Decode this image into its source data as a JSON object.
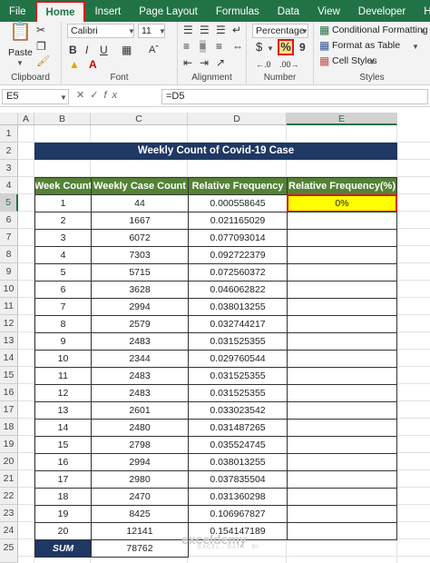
{
  "tabs": [
    {
      "label": "File",
      "active": false
    },
    {
      "label": "Home",
      "active": true
    },
    {
      "label": "Insert",
      "active": false
    },
    {
      "label": "Page Layout",
      "active": false
    },
    {
      "label": "Formulas",
      "active": false
    },
    {
      "label": "Data",
      "active": false
    },
    {
      "label": "View",
      "active": false
    },
    {
      "label": "Developer",
      "active": false
    },
    {
      "label": "Help",
      "active": false
    }
  ],
  "ribbon": {
    "clipboard": {
      "label": "Clipboard",
      "paste": "Paste"
    },
    "font": {
      "label": "Font",
      "name": "Calibri",
      "size": "11",
      "bold": "B",
      "italic": "I",
      "underline": "U"
    },
    "alignment": {
      "label": "Alignment"
    },
    "number": {
      "label": "Number",
      "format": "Percentage",
      "currency": "$",
      "percent": "%",
      "comma": "9"
    },
    "styles": {
      "label": "Styles",
      "conditional": "Conditional Formatting",
      "table": "Format as Table",
      "cell_styles": "Cell Styles"
    }
  },
  "formula_bar": {
    "name_box": "E5",
    "formula": "=D5"
  },
  "columns": [
    "A",
    "B",
    "C",
    "D",
    "E"
  ],
  "rows": [
    "1",
    "2",
    "3",
    "4",
    "5",
    "6",
    "7",
    "8",
    "9",
    "10",
    "11",
    "12",
    "13",
    "14",
    "15",
    "16",
    "17",
    "18",
    "19",
    "20",
    "21",
    "22",
    "23",
    "24",
    "25"
  ],
  "sheet": {
    "title": "Weekly Count of Covid-19 Case",
    "headers": [
      "Week Count",
      "Weekly Case Count",
      "Relative Frequency",
      "Relative Frequency(%)"
    ],
    "rows": [
      [
        "1",
        "44",
        "0.000558645",
        "0%"
      ],
      [
        "2",
        "1667",
        "0.021165029",
        ""
      ],
      [
        "3",
        "6072",
        "0.077093014",
        ""
      ],
      [
        "4",
        "7303",
        "0.092722379",
        ""
      ],
      [
        "5",
        "5715",
        "0.072560372",
        ""
      ],
      [
        "6",
        "3628",
        "0.046062822",
        ""
      ],
      [
        "7",
        "2994",
        "0.038013255",
        ""
      ],
      [
        "8",
        "2579",
        "0.032744217",
        ""
      ],
      [
        "9",
        "2483",
        "0.031525355",
        ""
      ],
      [
        "10",
        "2344",
        "0.029760544",
        ""
      ],
      [
        "11",
        "2483",
        "0.031525355",
        ""
      ],
      [
        "12",
        "2483",
        "0.031525355",
        ""
      ],
      [
        "13",
        "2601",
        "0.033023542",
        ""
      ],
      [
        "14",
        "2480",
        "0.031487265",
        ""
      ],
      [
        "15",
        "2798",
        "0.035524745",
        ""
      ],
      [
        "16",
        "2994",
        "0.038013255",
        ""
      ],
      [
        "17",
        "2980",
        "0.037835504",
        ""
      ],
      [
        "18",
        "2470",
        "0.031360298",
        ""
      ],
      [
        "19",
        "8425",
        "0.106967827",
        ""
      ],
      [
        "20",
        "12141",
        "0.154147189",
        ""
      ]
    ],
    "sum_label": "SUM",
    "sum_value": "78762"
  },
  "watermark": {
    "name": "exceldemy",
    "tagline": "EXCEL · DATA · BI"
  },
  "colors": {
    "ribbon_green": "#217346",
    "header_green": "#548235",
    "navy": "#1f3864",
    "highlight": "#ffff00",
    "red_outline": "#e0131a"
  }
}
